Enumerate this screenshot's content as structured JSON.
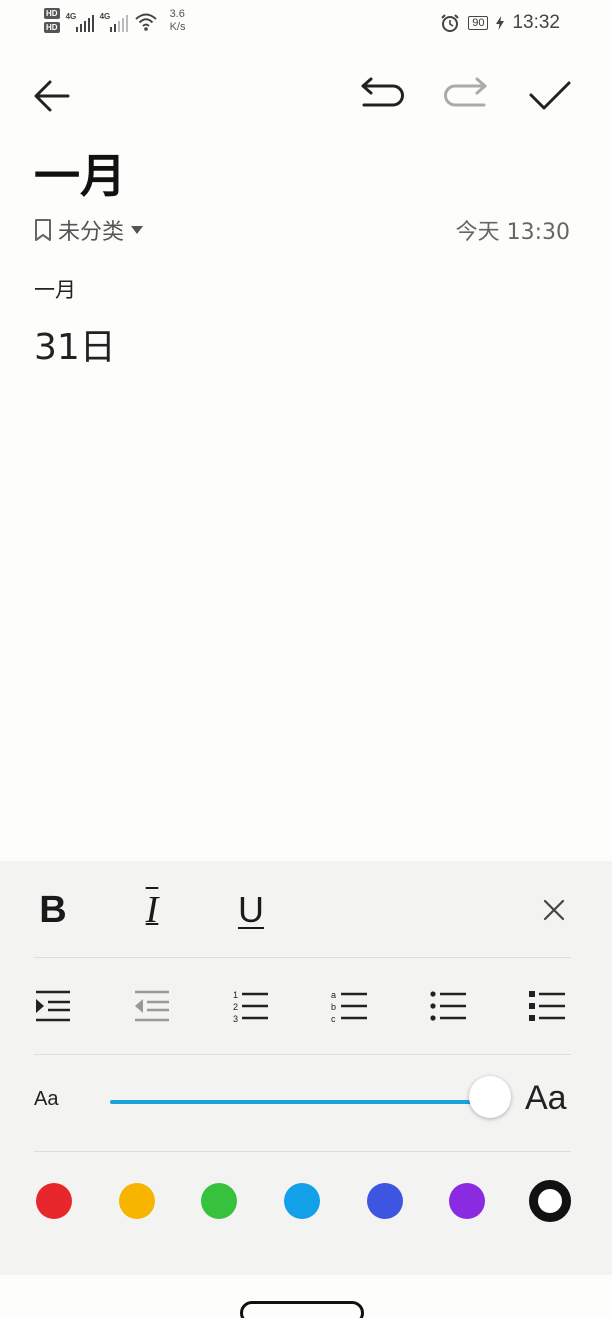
{
  "status_bar": {
    "hd1": "HD",
    "hd2": "HD",
    "net1": "4G",
    "net2": "4G",
    "speed_value": "3.6",
    "speed_unit": "K/s",
    "battery": "90",
    "time": "13:32"
  },
  "toolbar": {
    "back_icon": "arrow-left-icon",
    "undo_icon": "undo-icon",
    "redo_icon": "redo-icon",
    "done_icon": "check-icon"
  },
  "note": {
    "title": "一月",
    "category": "未分类",
    "timestamp": "今天 13:30",
    "body_line1": "一月",
    "body_line2": "31日"
  },
  "format_panel": {
    "bold_label": "B",
    "italic_label": "I",
    "underline_label": "U",
    "font_size_small_label": "Aa",
    "font_size_large_label": "Aa",
    "font_size_level": 1.0,
    "colors": [
      "#e8272c",
      "#f7b500",
      "#36c23c",
      "#12a0e8",
      "#3d55e0",
      "#8a2be2"
    ],
    "selected_color": "#111111",
    "accent": "#1aa3dd"
  }
}
